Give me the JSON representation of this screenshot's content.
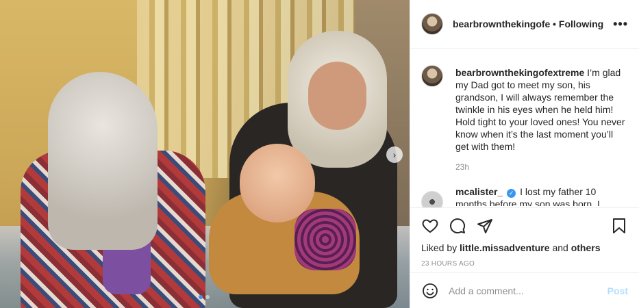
{
  "post": {
    "author": "bearbrownthekingofextreme",
    "header_username": "bearbrownthekingofe",
    "header_separator": "•",
    "follow_status": "Following",
    "more_label": "•••",
    "caption": {
      "username": "bearbrownthekingofextreme",
      "text": "I’m glad my Dad got to meet my son, his grandson, I will always remember the twinkle in his eyes when he held him! Hold tight to your loved ones! You never know when it’s the last moment you’ll get with them!",
      "time": "23h"
    },
    "reply": {
      "username": "mcalister_",
      "verified_mark": "✓",
      "text": "I lost my father 10 months before my son was born. I"
    },
    "liked_by_prefix": "Liked by",
    "liked_by_user": "little.missadventure",
    "liked_by_and": "and",
    "liked_by_others": "others",
    "timestamp": "23 hours ago",
    "comment_placeholder": "Add a comment...",
    "post_button": "Post",
    "next_button": "›"
  },
  "carousel": {
    "count": 2,
    "active_index": 0
  },
  "icons": {
    "like": "heart-icon",
    "comment": "comment-bubble-icon",
    "share": "paper-plane-icon",
    "save": "bookmark-icon",
    "emoji": "smiley-icon"
  },
  "colors": {
    "accent": "#3897f0",
    "post_disabled": "#b2dffc",
    "muted": "#8e8e8e"
  }
}
